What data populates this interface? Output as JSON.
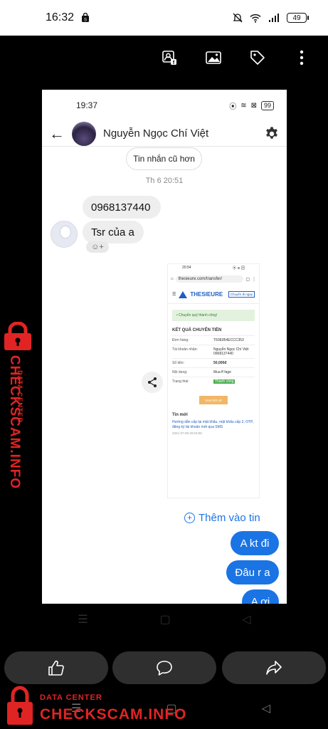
{
  "outer_status": {
    "time": "16:32",
    "battery": "49"
  },
  "inner_status": {
    "time": "19:37",
    "battery": "99"
  },
  "chat": {
    "contact_name": "Nguyễn Ngọc Chí Việt",
    "older_messages_label": "Tin nhắn cũ hơn",
    "timestamp": "Th 6 20:51",
    "incoming": [
      "0968137440",
      "Tsr của a"
    ],
    "add_story_label": "Thêm vào tin",
    "outgoing": [
      "A kt đi",
      "Đâu r a",
      "A ơi"
    ]
  },
  "nested": {
    "time": "20:54",
    "url": "thesieure.com/transfer/",
    "brand": "THESIEURE",
    "transfer_button": "Chuyển đi ngay",
    "success": "• Chuyển quỹ thành công!",
    "result_title": "KẾT QUẢ CHUYỂN TIỀN",
    "rows": [
      {
        "k": "Đơn hàng:",
        "v": "T60E854ECCC353"
      },
      {
        "k": "Tài khoản nhận:",
        "v": "Nguyễn Ngọc Chí Việt 0968137440"
      },
      {
        "k": "Số tiền:",
        "v": "50,000đ"
      },
      {
        "k": "Nội dung:",
        "v": "Mua ff fage"
      },
      {
        "k": "Trạng thái:",
        "v": "Thành công"
      }
    ],
    "history_button": "Xem lịch sử",
    "news_title": "Tin mới",
    "article": "Hướng dẫn cấp lại mật khẩu, mật khẩu cấp 2, OTP, đăng ký tài khoản mới qua SMS",
    "article_date": "2021-07-08 20:53:58"
  },
  "watermark": {
    "small": "DATA CENTER",
    "big": "CHECKSCAM.INFO"
  },
  "icons": {
    "viewer": [
      "tag-facebook-icon",
      "image-icon",
      "tag-icon",
      "more-vert-icon"
    ],
    "actions": [
      "like-icon",
      "comment-icon",
      "share-icon"
    ]
  }
}
